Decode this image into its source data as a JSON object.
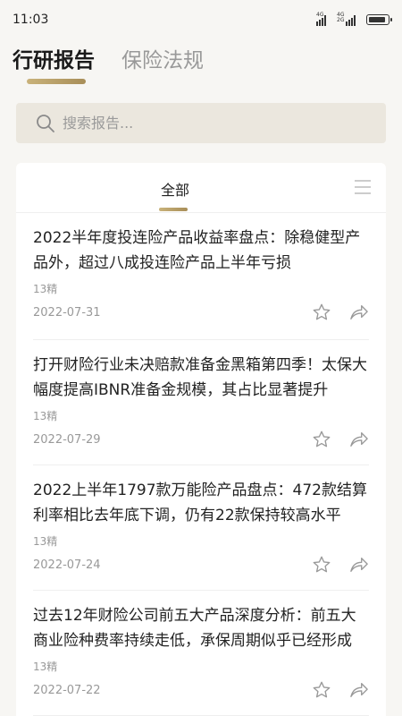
{
  "status_bar": {
    "time": "11:03",
    "network_1": "4G",
    "network_2": "4G 2G",
    "icons": [
      "signal-icon",
      "signal-icon",
      "battery-icon"
    ]
  },
  "top_tabs": [
    {
      "label": "行研报告",
      "active": true
    },
    {
      "label": "保险法规",
      "active": false
    }
  ],
  "search": {
    "placeholder": "搜索报告...",
    "icon": "search-icon"
  },
  "sub_tabs": {
    "all_label": "全部",
    "menu_icon": "list-menu-icon"
  },
  "reports": [
    {
      "title": "2022半年度投连险产品收益率盘点：除稳健型产品外，超过八成投连险产品上半年亏损",
      "source": "13精",
      "date": "2022-07-31"
    },
    {
      "title": "打开财险行业未决赔款准备金黑箱第四季！太保大幅度提高IBNR准备金规模，其占比显著提升",
      "source": "13精",
      "date": "2022-07-29"
    },
    {
      "title": "2022上半年1797款万能险产品盘点：472款结算利率相比去年底下调，仍有22款保持较高水平",
      "source": "13精",
      "date": "2022-07-24"
    },
    {
      "title": "过去12年财险公司前五大产品深度分析：前五大商业险种费率持续走低，承保周期似乎已经形成",
      "source": "13精",
      "date": "2022-07-22"
    }
  ],
  "colors": {
    "accent": "#b59c66",
    "background": "#f7f6f3",
    "search_bg": "#ebe7de"
  }
}
